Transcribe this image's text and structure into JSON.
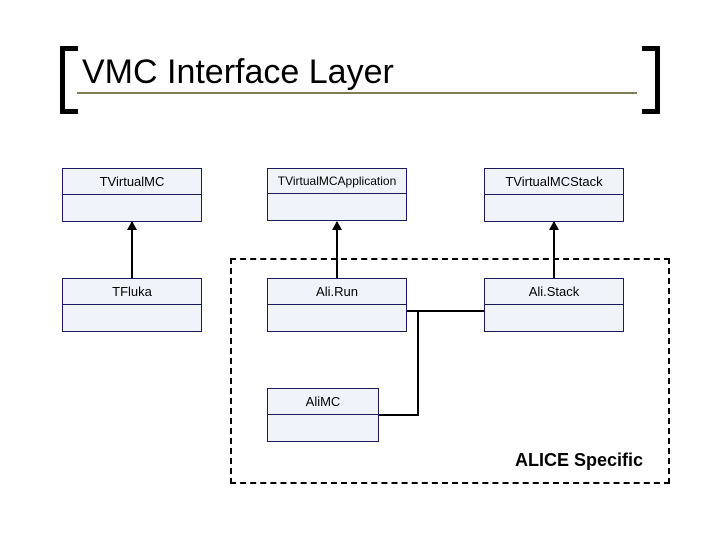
{
  "title": "VMC Interface Layer",
  "boxes": {
    "tvirtualmc": "TVirtualMC",
    "tvirtualmcapplication": "TVirtualMCApplication",
    "tvirtualmcstack": "TVirtualMCStack",
    "tfluka": "TFluka",
    "alirun": "Ali.Run",
    "alistack": "Ali.Stack",
    "alimc": "AliMC"
  },
  "group_label": "ALICE Specific",
  "chart_data": {
    "type": "uml",
    "title": "VMC Interface Layer",
    "nodes": [
      {
        "id": "TVirtualMC",
        "row": 0,
        "col": 0
      },
      {
        "id": "TVirtualMCApplication",
        "row": 0,
        "col": 1
      },
      {
        "id": "TVirtualMCStack",
        "row": 0,
        "col": 2
      },
      {
        "id": "TFluka",
        "row": 1,
        "col": 0
      },
      {
        "id": "Ali.Run",
        "row": 1,
        "col": 1
      },
      {
        "id": "Ali.Stack",
        "row": 1,
        "col": 2
      },
      {
        "id": "AliMC",
        "row": 2,
        "col": 1
      }
    ],
    "edges": [
      {
        "from": "TFluka",
        "to": "TVirtualMC",
        "kind": "inheritance"
      },
      {
        "from": "Ali.Run",
        "to": "TVirtualMCApplication",
        "kind": "inheritance"
      },
      {
        "from": "Ali.Stack",
        "to": "TVirtualMCStack",
        "kind": "inheritance"
      },
      {
        "from": "AliMC",
        "to": "Ali.Run",
        "kind": "association"
      },
      {
        "from": "AliMC",
        "to": "Ali.Stack",
        "kind": "association"
      }
    ],
    "groups": [
      {
        "label": "ALICE Specific",
        "members": [
          "Ali.Run",
          "Ali.Stack",
          "AliMC"
        ]
      }
    ]
  }
}
